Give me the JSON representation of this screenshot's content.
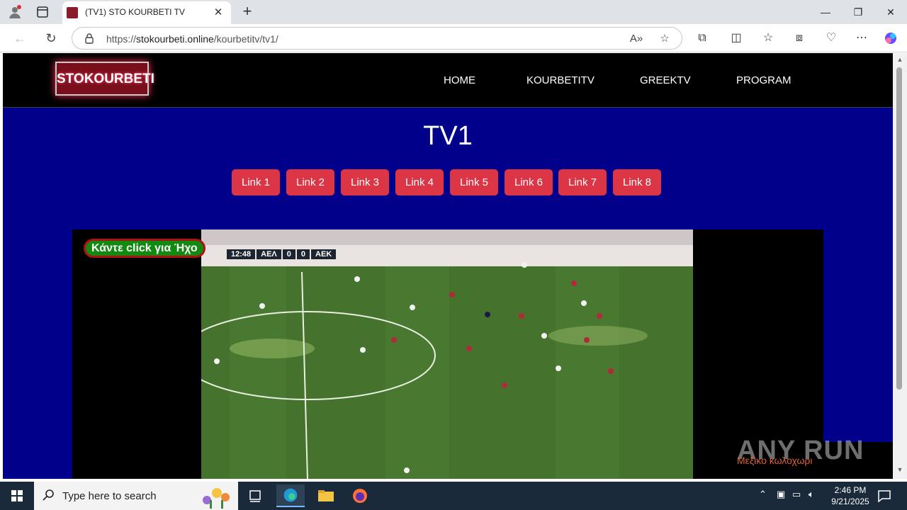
{
  "browser": {
    "tab_title": "(TV1) STO KOURBETI TV",
    "new_tab_symbol": "+",
    "url_prefix": "https://",
    "url_host": "stokourbeti.online",
    "url_path": "/kourbetitv/tv1/",
    "window": {
      "minimize": "—",
      "restore": "❐",
      "close": "✕"
    }
  },
  "site": {
    "logo_text": "STOKOURBETI",
    "nav": [
      "HOME",
      "KOURBETITV",
      "GREEKTV",
      "PROGRAM"
    ],
    "title": "TV1",
    "links": [
      "Link 1",
      "Link 2",
      "Link 3",
      "Link 4",
      "Link 5",
      "Link 6",
      "Link 7",
      "Link 8"
    ],
    "sound_badge": "Κάντε click για Ήχο",
    "scoreboard": {
      "time": "12:48",
      "home": "ΑΕΛ",
      "home_score": "0",
      "away_score": "0",
      "away": "ΑΕΚ"
    },
    "watermark_caption": "Μεξικο κωλοχωρι"
  },
  "overlay": {
    "brand": "ANY RUN"
  },
  "taskbar": {
    "search_placeholder": "Type here to search",
    "time": "2:46 PM",
    "date": "9/21/2025"
  },
  "colors": {
    "page_bg": "#00008b",
    "header_bg": "#000000",
    "link_button": "#dc3545",
    "sound_badge_bg": "#118a11",
    "sound_badge_border": "#b01010"
  }
}
